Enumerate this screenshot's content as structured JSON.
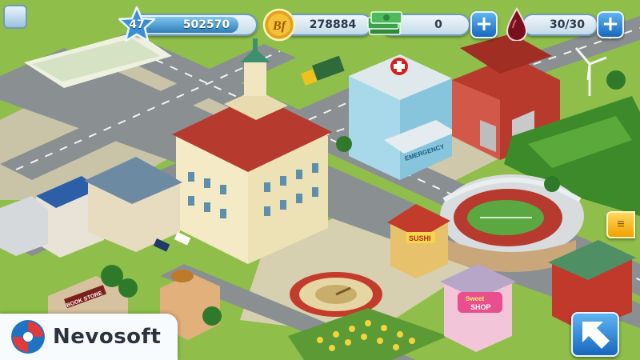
{
  "hud": {
    "level": "47",
    "experience": "502570",
    "coins": "278884",
    "cash": "0",
    "energy": "30/30",
    "plus_label": "+"
  },
  "signs": {
    "emergency": "EMERGENCY",
    "sushi": "SUSHI",
    "bookstore": "BOOK STORE",
    "sweet_shop_line1": "Sweet",
    "sweet_shop_line2": "SHOP",
    "coin_symbol": "Bf"
  },
  "branding": {
    "logo_text": "Nevosoft"
  },
  "colors": {
    "hud_blue": "#2f7db8",
    "button_blue": "#1768bd",
    "grass": "#8fbf4a",
    "road": "#8a8f92",
    "roof_red": "#c0392b"
  },
  "icons": {
    "level": "star-icon",
    "coins": "coin-icon",
    "cash": "cash-stack-icon",
    "energy": "energy-drop-icon",
    "corner": "menu-icon",
    "side": "side-panel-icon",
    "action": "arrow-button-icon"
  }
}
